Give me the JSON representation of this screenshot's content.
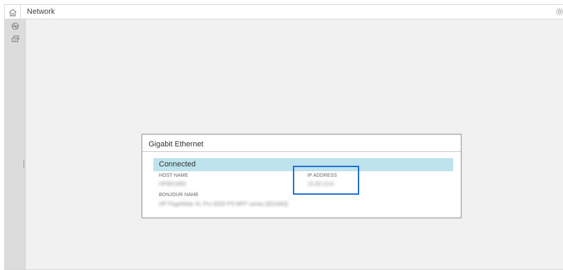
{
  "header": {
    "title": "Network"
  },
  "icons": {
    "home": "home-icon",
    "settings": "gear-icon",
    "sidebar": [
      "network-icon",
      "print-queue-icon"
    ]
  },
  "dialog": {
    "title": "Gigabit Ethernet",
    "status": "Connected",
    "host_name_label": "HOST NAME",
    "host_name_value": "HP9D1683",
    "ip_address_label": "IP ADDRESS",
    "ip_address_value": "15.83.10.6",
    "bonjour_name_label": "BONJOUR NAME",
    "bonjour_name_value": "HP PageWide XL Pro 8200 PS MFP series [9D1683]"
  },
  "colors": {
    "status_bar": "#bee3ec",
    "highlight": "#1e6ed6",
    "sidebar": "#dcdcdc",
    "background": "#f1f1f1"
  }
}
